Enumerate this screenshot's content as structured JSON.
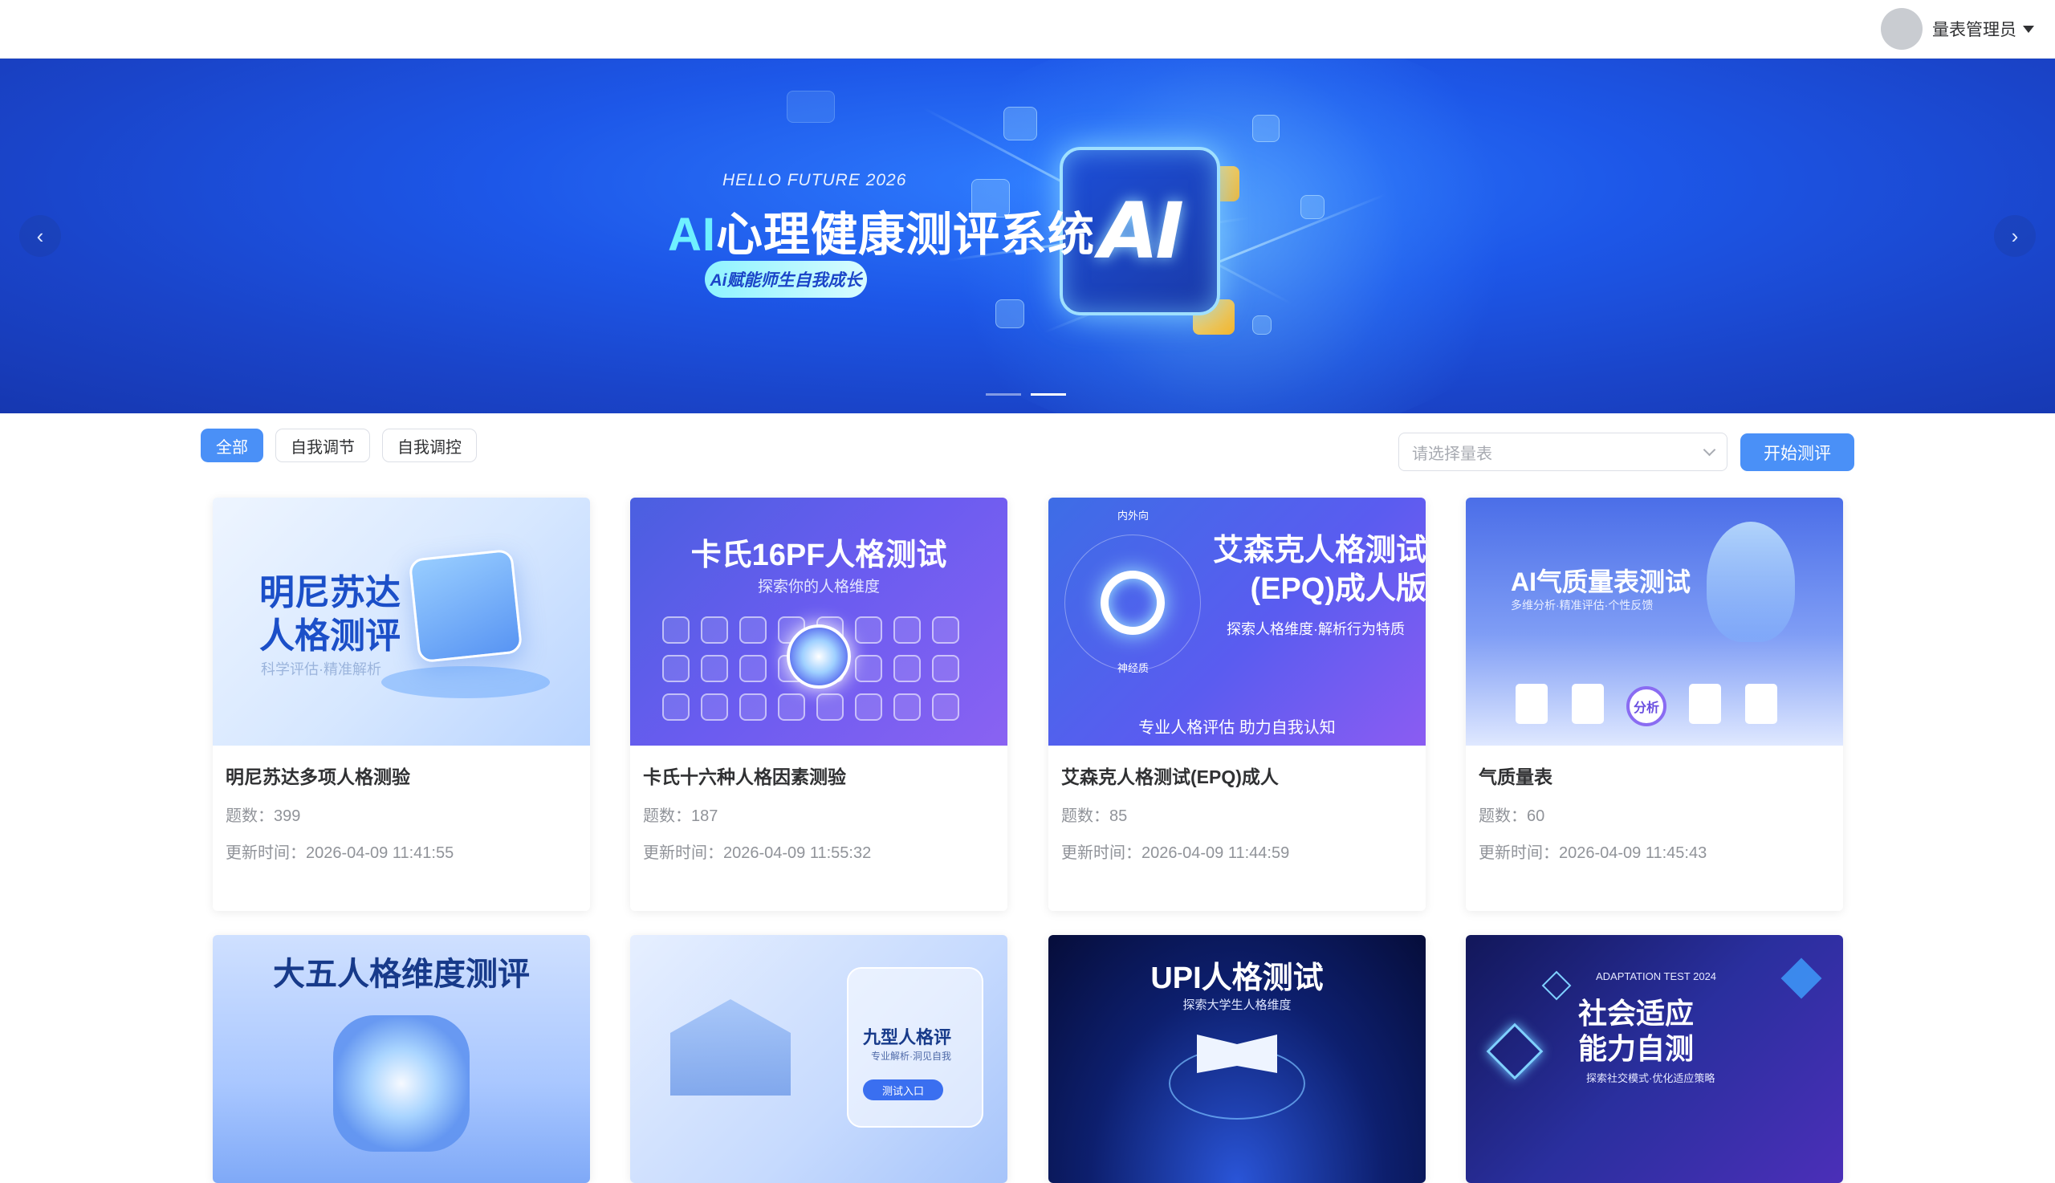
{
  "header": {
    "username": "量表管理员"
  },
  "banner": {
    "kicker": "HELLO FUTURE 2026",
    "headline_ai": "AI",
    "headline_rest": "心理健康测评系统",
    "tagline": "Ai赋能师生自我成长",
    "center_logo": "AI",
    "prev_glyph": "‹",
    "next_glyph": "›",
    "slide_count": 2,
    "active_slide": 2
  },
  "filters": {
    "tags": [
      "全部",
      "自我调节",
      "自我调控"
    ],
    "active": "全部"
  },
  "toolbar": {
    "select_placeholder": "请选择量表",
    "start_label": "开始测评"
  },
  "labels": {
    "count": "题数：",
    "updated": "更新时间："
  },
  "cards": [
    {
      "name": "明尼苏达多项人格测验",
      "count": "399",
      "updated": "2026-04-09 11:41:55",
      "cover_title": "明尼苏达\n人格测评",
      "cover_sub": "科学评估·精准解析"
    },
    {
      "name": "卡氏十六种人格因素测验",
      "count": "187",
      "updated": "2026-04-09 11:55:32",
      "cover_title": "卡氏16PF人格测试",
      "cover_sub": "探索你的人格维度"
    },
    {
      "name": "艾森克人格测试(EPQ)成人",
      "count": "85",
      "updated": "2026-04-09 11:44:59",
      "cover_title": "艾森克人格测试\n(EPQ)成人版",
      "cover_sub": "探索人格维度·解析行为特质",
      "cover_footer": "专业人格评估 助力自我认知",
      "cover_tag_top": "内外向",
      "cover_tag_bottom": "神经质"
    },
    {
      "name": "气质量表",
      "count": "60",
      "updated": "2026-04-09 11:45:43",
      "cover_title": "AI气质量表测试",
      "cover_sub": "多维分析·精准评估·个性反馈",
      "cover_badge": "分析"
    },
    {
      "cover_title": "大五人格维度测评"
    },
    {
      "cover_title": "九型人格评",
      "cover_sub": "专业解析·洞见自我",
      "cover_button": "测试入口"
    },
    {
      "cover_title": "UPI人格测试",
      "cover_sub": "探索大学生人格维度"
    },
    {
      "cover_kicker": "ADAPTATION TEST 2024",
      "cover_title": "社会适应\n能力自测",
      "cover_sub": "探索社交模式·优化适应策略"
    }
  ]
}
